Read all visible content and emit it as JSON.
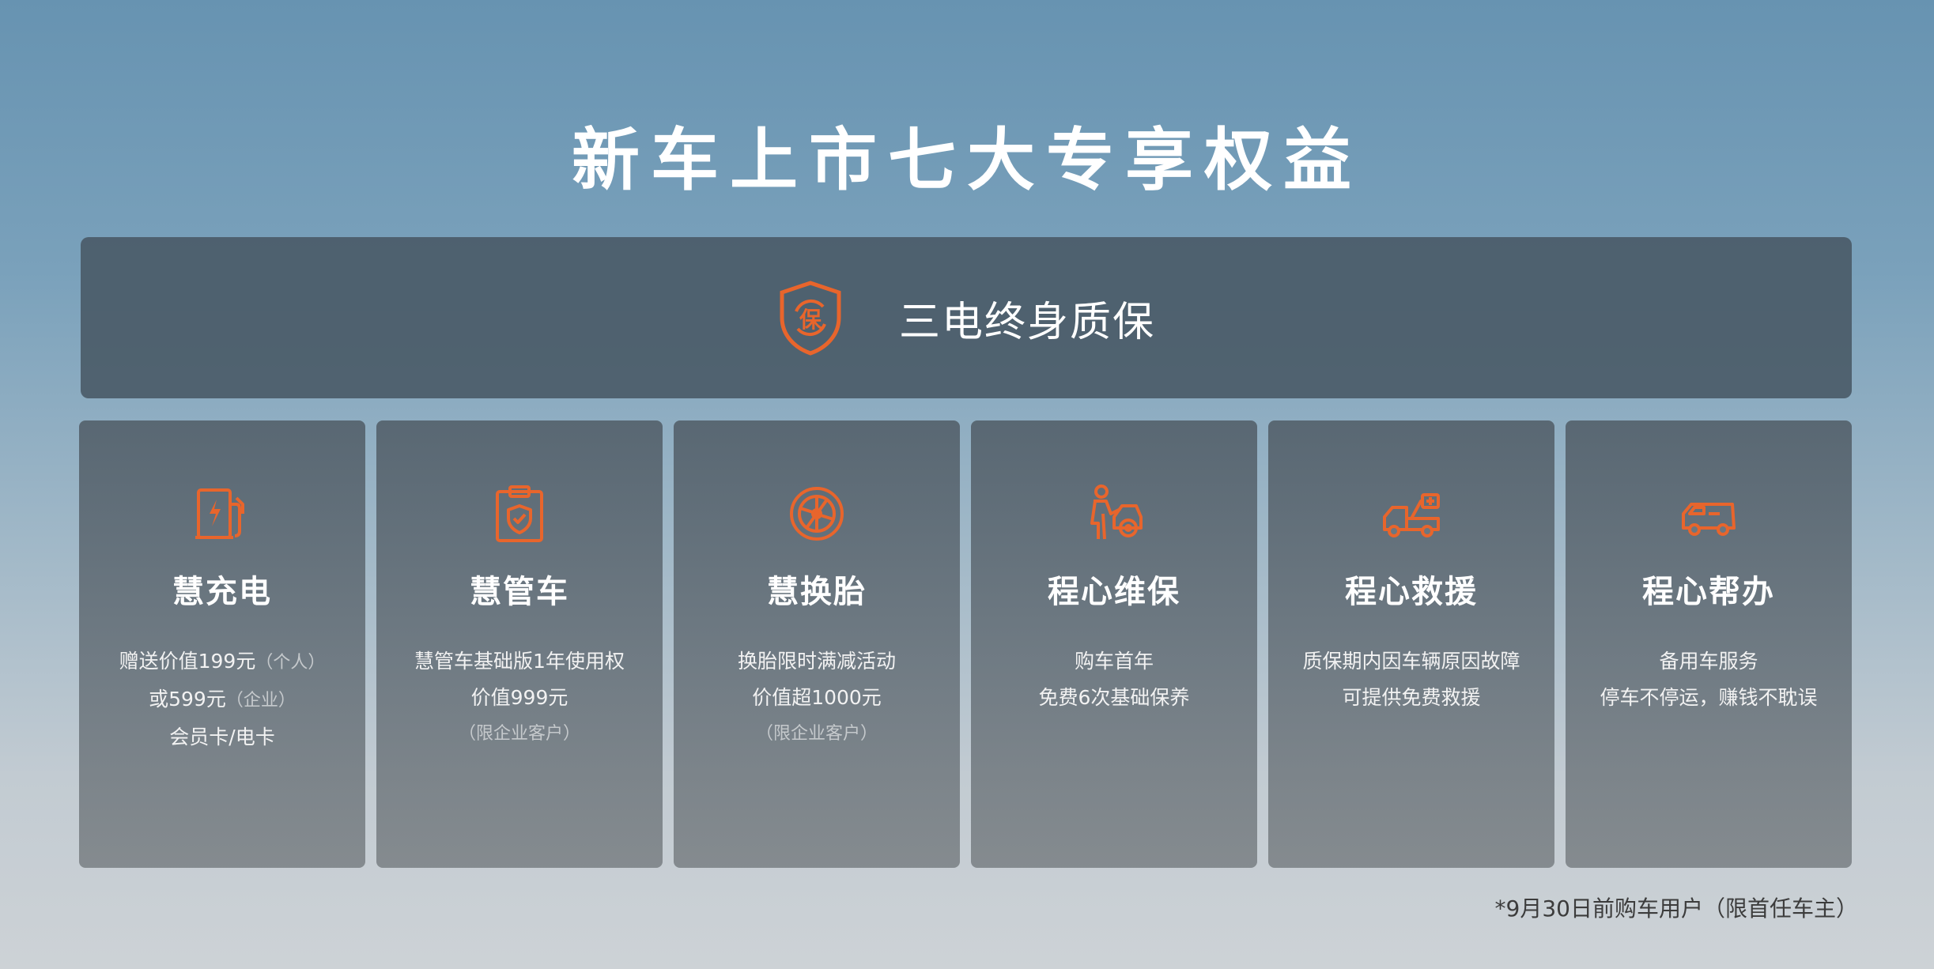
{
  "title": "新车上市七大专享权益",
  "banner": {
    "icon": "shield-bao-icon",
    "icon_text": "保",
    "label": "三电终身质保"
  },
  "accent_color": "#e8652c",
  "cards": [
    {
      "icon": "charging-station-icon",
      "title": "慧充电",
      "line1": "赠送价值199元",
      "line1_note": "（个人）",
      "line2": "或599元",
      "line2_note": "（企业）",
      "line3": "会员卡/电卡"
    },
    {
      "icon": "clipboard-shield-icon",
      "title": "慧管车",
      "line1": "慧管车基础版1年使用权",
      "line2": "价值999元",
      "line3_note": "（限企业客户）"
    },
    {
      "icon": "tire-icon",
      "title": "慧换胎",
      "line1": "换胎限时满减活动",
      "line2": "价值超1000元",
      "line3_note": "（限企业客户）"
    },
    {
      "icon": "mechanic-icon",
      "title": "程心维保",
      "line1": "购车首年",
      "line2": "免费6次基础保养"
    },
    {
      "icon": "rescue-truck-icon",
      "title": "程心救援",
      "line1": "质保期内因车辆原因故障",
      "line2": "可提供免费救援"
    },
    {
      "icon": "van-icon",
      "title": "程心帮办",
      "line1": "备用车服务",
      "line2": "停车不停运，赚钱不耽误"
    }
  ],
  "footnote": "*9月30日前购车用户（限首任车主）"
}
